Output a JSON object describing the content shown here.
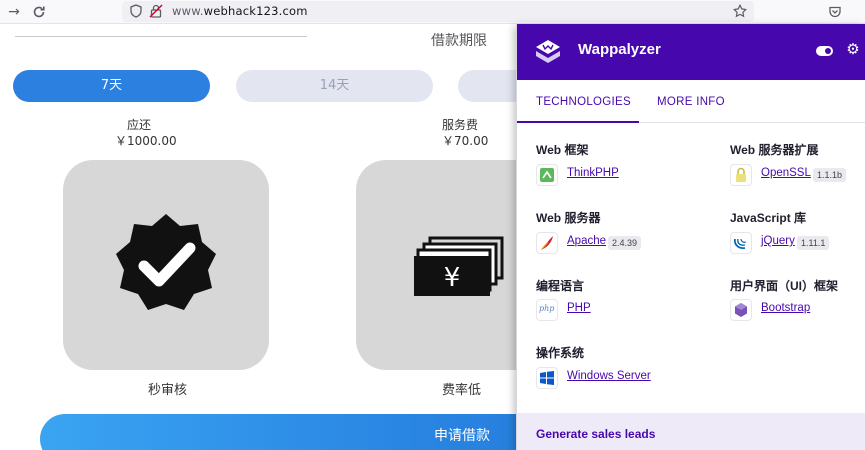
{
  "browser": {
    "url_domain": "www.webhack123.com",
    "url_prefix": "www.",
    "url_host": "webhack123.com",
    "icons": [
      "back-icon",
      "reload-icon",
      "shield-icon",
      "lock-insecure-icon",
      "bookmark-star-icon",
      "pocket-icon"
    ]
  },
  "page": {
    "term_label": "借款期限",
    "pills": {
      "active": "7天",
      "inactive": "14天"
    },
    "repay_label": "应还",
    "repay_value": "￥1000.00",
    "fee_label": "服务费",
    "fee_value": "￥70.00",
    "features": [
      {
        "icon": "verified-badge-icon",
        "caption": "秒审核"
      },
      {
        "icon": "yen-banknotes-icon",
        "caption": "费率低"
      }
    ],
    "banknote_symbol": "¥",
    "apply_button": "申请借款"
  },
  "wappalyzer": {
    "title": "Wappalyzer",
    "brand_color": "#4608ad",
    "tabs": {
      "technologies": "TECHNOLOGIES",
      "more_info": "MORE INFO"
    },
    "categories": [
      {
        "title": "Web 框架",
        "techs": [
          {
            "name": "ThinkPHP",
            "version": "",
            "icon": "thinkphp-icon"
          }
        ]
      },
      {
        "title": "Web 服务器扩展",
        "techs": [
          {
            "name": "OpenSSL",
            "version": "1.1.1b",
            "icon": "openssl-lock-icon"
          }
        ]
      },
      {
        "title": "Web 服务器",
        "techs": [
          {
            "name": "Apache",
            "version": "2.4.39",
            "icon": "apache-feather-icon"
          }
        ]
      },
      {
        "title": "JavaScript 库",
        "techs": [
          {
            "name": "jQuery",
            "version": "1.11.1",
            "icon": "jquery-icon"
          }
        ]
      },
      {
        "title": "编程语言",
        "techs": [
          {
            "name": "PHP",
            "version": "",
            "icon": "php-icon"
          }
        ]
      },
      {
        "title": "用户界面（UI）框架",
        "techs": [
          {
            "name": "Bootstrap",
            "version": "",
            "icon": "bootstrap-icon"
          }
        ]
      },
      {
        "title": "操作系统",
        "techs": [
          {
            "name": "Windows Server",
            "version": "",
            "icon": "windows-icon"
          }
        ]
      }
    ],
    "php_icon_text": "php",
    "footer": "Generate sales leads"
  }
}
